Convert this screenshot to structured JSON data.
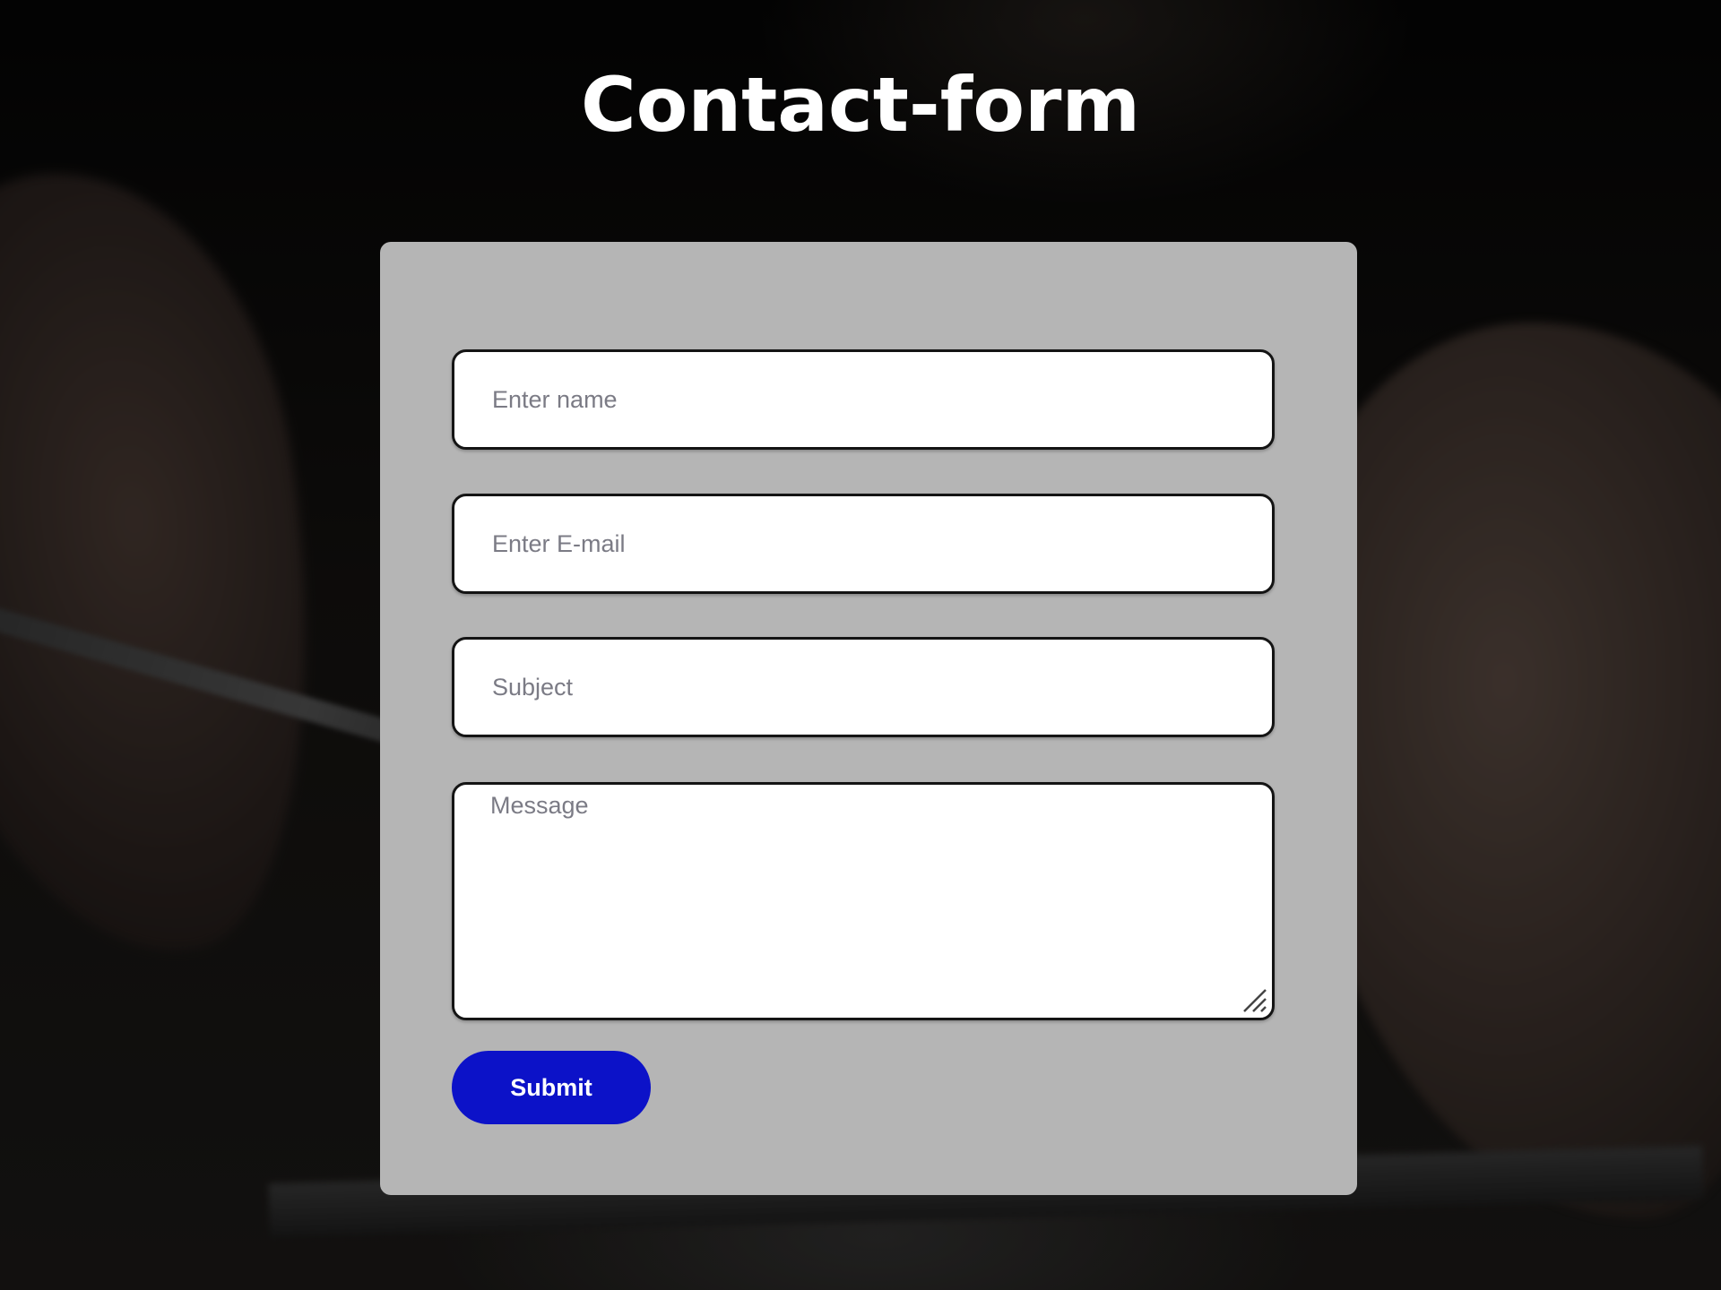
{
  "page": {
    "title": "Contact-form"
  },
  "form": {
    "name_placeholder": "Enter name",
    "email_placeholder": "Enter E-mail",
    "subject_placeholder": "Subject",
    "message_placeholder": "Message",
    "name_value": "",
    "email_value": "",
    "subject_value": "",
    "message_value": "",
    "submit_label": "Submit"
  },
  "colors": {
    "card_background": "#b5b5b5",
    "submit_background": "#0c12c8",
    "title_color": "#ffffff",
    "input_border": "#141414"
  }
}
